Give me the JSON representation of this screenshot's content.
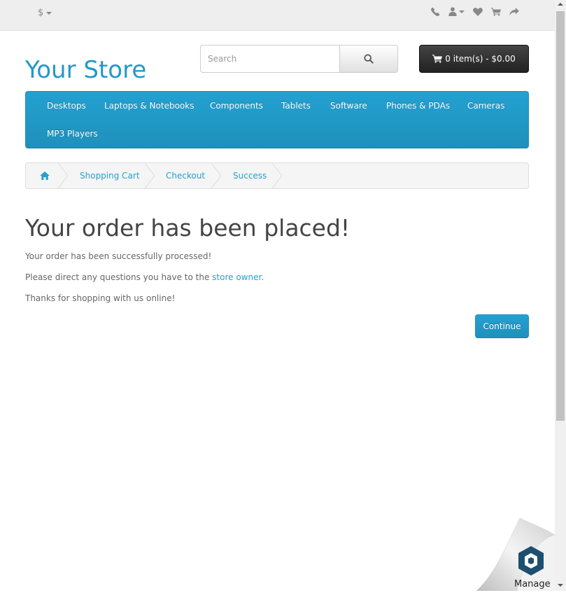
{
  "top_bar": {
    "currency_symbol": "$",
    "icons": [
      "phone-icon",
      "user-icon",
      "heart-icon",
      "cart-icon",
      "share-icon"
    ]
  },
  "header": {
    "logo_text": "Your Store",
    "search_placeholder": "Search",
    "search_value": "",
    "cart_label": "0 item(s) - $0.00"
  },
  "menu": {
    "items": [
      "Desktops",
      "Laptops & Notebooks",
      "Components",
      "Tablets",
      "Software",
      "Phones & PDAs",
      "Cameras",
      "MP3 Players"
    ]
  },
  "breadcrumb": {
    "home_icon": "home-icon",
    "items": [
      "Shopping Cart",
      "Checkout",
      "Success"
    ]
  },
  "content": {
    "title": "Your order has been placed!",
    "line1": "Your order has been successfully processed!",
    "line2_prefix": "Please direct any questions you have to the ",
    "line2_link": "store owner",
    "line2_suffix": ".",
    "line3": "Thanks for shopping with us online!",
    "continue_label": "Continue"
  },
  "widget": {
    "label": "Manage"
  },
  "colors": {
    "accent": "#229ac8",
    "menu_bg": "#1f90bb",
    "cart_button": "#303030",
    "top_bar": "#eeeeee"
  }
}
